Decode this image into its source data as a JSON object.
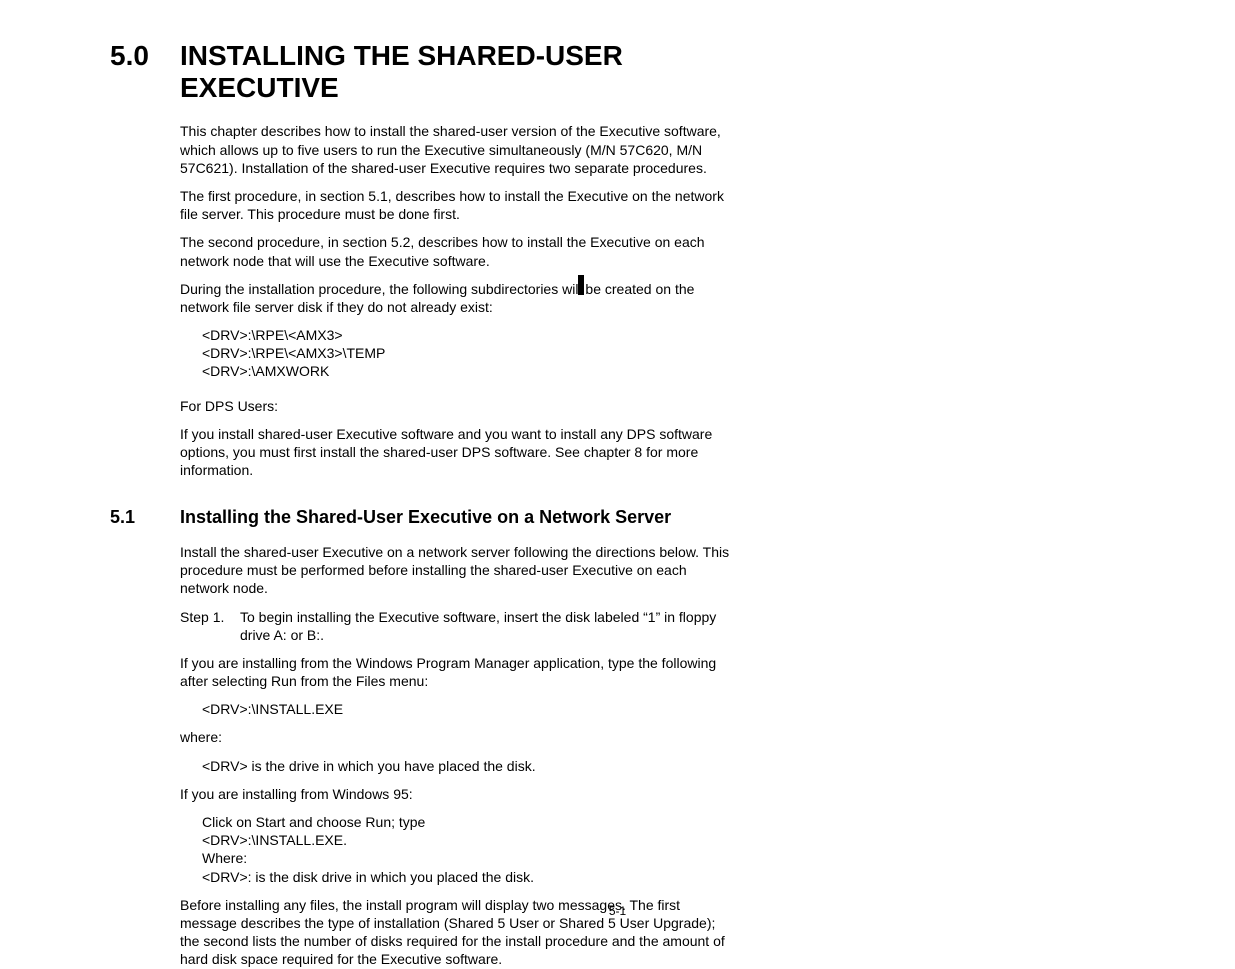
{
  "section": {
    "number": "5.0",
    "title": "INSTALLING THE SHARED-USER EXECUTIVE",
    "p1": "This chapter describes how to install the shared-user version of the Executive software, which allows up to five users to run the Executive simultaneously (M/N 57C620, M/N 57C621). Installation of the shared-user Executive requires two separate procedures.",
    "p2": "The first procedure, in section 5.1, describes how to install the Executive on the network file server. This procedure must be done first.",
    "p3": "The second procedure, in section 5.2, describes how to install the Executive on each network node that will use the Executive software.",
    "p4": "During the installation procedure, the following subdirectories will be created on the network file server disk if they do not already exist:",
    "dir1": "<DRV>:\\RPE\\<AMX3>",
    "dir2": "<DRV>:\\RPE\\<AMX3>\\TEMP",
    "dir3": "<DRV>:\\AMXWORK",
    "p5": "For DPS Users:",
    "p6": "If you install shared-user Executive software and you want to install any DPS software options, you must first install the shared-user DPS software. See chapter 8 for more information."
  },
  "subsection": {
    "number": "5.1",
    "title": "Installing the Shared-User Executive on a Network Server",
    "p1": "Install the shared-user Executive on a network server following the directions below. This procedure must be performed before installing the shared-user Executive on each network node.",
    "step1_label": "Step 1.",
    "step1_text": "To begin installing the Executive software, insert the disk labeled “1” in floppy drive A: or B:.",
    "p2": "If you are installing from the Windows Program Manager application, type the following after selecting Run from the Files menu:",
    "cmd1": "<DRV>:\\INSTALL.EXE",
    "p3": "where:",
    "p4": "<DRV> is the drive in which you have placed the disk.",
    "p5": "If you are installing from Windows 95:",
    "p6a": "Click on Start and choose Run; type",
    "p6b": "<DRV>:\\INSTALL.EXE.",
    "p6c": "Where:",
    "p6d": "<DRV>: is the disk drive in which you placed the disk.",
    "p7": "Before installing any files, the install program will display two messages. The first message describes the type of installation (Shared 5 User or Shared 5 User Upgrade); the second lists the number of disks required for the install procedure and the amount of hard disk space required for the Executive software."
  },
  "page_number": "5-1"
}
